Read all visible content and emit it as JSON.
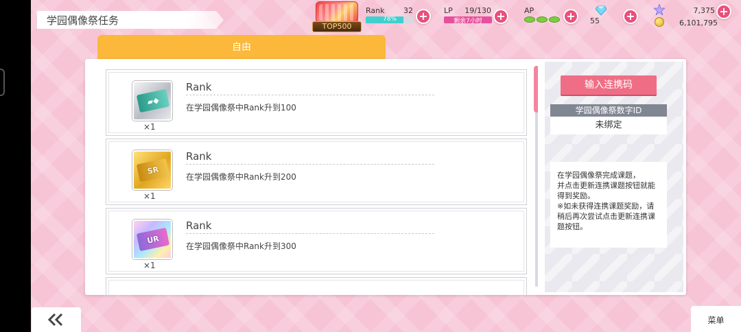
{
  "header": {
    "title": "学园偶像祭任务"
  },
  "event": {
    "badge_text": "TOP500"
  },
  "status": {
    "rank_label": "Rank",
    "rank_value": "32",
    "rank_progress_text": "78%",
    "rank_progress": 0.78,
    "lp_label": "LP",
    "lp_value": "19/130",
    "lp_remaining_text": "剩余7小时",
    "lp_progress": 0.146,
    "ap_label": "AP",
    "gems": "55",
    "stars": "7,375",
    "coins": "6,101,795"
  },
  "tabs": [
    {
      "label": "自由"
    }
  ],
  "missions": [
    {
      "title": "Rank",
      "description": "在学园偶像祭中Rank升到100",
      "reward_icon": "silver-ticket-icon",
      "quantity": "×1"
    },
    {
      "title": "Rank",
      "description": "在学园偶像祭中Rank升到200",
      "reward_icon": "sr-ticket-icon",
      "reward_text": "SR",
      "quantity": "×1"
    },
    {
      "title": "Rank",
      "description": "在学园偶像祭中Rank升到300",
      "reward_icon": "ur-ticket-icon",
      "reward_text": "UR",
      "quantity": "×1"
    }
  ],
  "sidebar": {
    "link_button": "输入连携码",
    "id_header": "学园偶像祭数字ID",
    "id_value": "未绑定",
    "info_lines": [
      "在学园偶像祭完成课题，",
      "并点击更新连携课题按钮就能",
      "得到奖励。",
      "※如未获得连携课题奖励，请",
      "稍后再次尝试点击更新连携课",
      "题按钮。"
    ]
  },
  "footer": {
    "menu_label": "菜单"
  },
  "colors": {
    "accent_pink": "#ea4f7c",
    "tab_orange": "#fbb83a",
    "button_pink": "#f06e85",
    "rank_bar": "#40d0d0",
    "lp_bar": "#e94f9c"
  }
}
